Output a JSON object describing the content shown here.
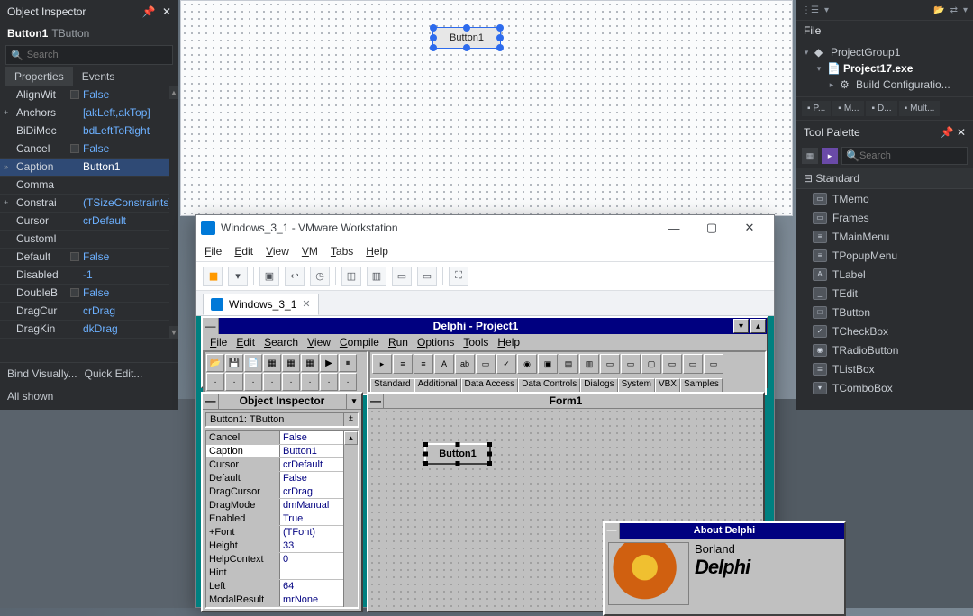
{
  "left": {
    "title": "Object Inspector",
    "selected_component": "Button1",
    "selected_class": "TButton",
    "search_placeholder": "Search",
    "tab_properties": "Properties",
    "tab_events": "Events",
    "rows": [
      {
        "expand": "",
        "name": "AlignWit",
        "check": true,
        "value": "False"
      },
      {
        "expand": "+",
        "name": "Anchors",
        "check": false,
        "value": "[akLeft,akTop]"
      },
      {
        "expand": "",
        "name": "BiDiMoc",
        "check": false,
        "value": "bdLeftToRight"
      },
      {
        "expand": "",
        "name": "Cancel",
        "check": true,
        "value": "False"
      },
      {
        "expand": "»",
        "name": "Caption",
        "check": false,
        "value": "Button1",
        "sel": true
      },
      {
        "expand": "",
        "name": "Comma",
        "check": false,
        "value": ""
      },
      {
        "expand": "+",
        "name": "Constrai",
        "check": false,
        "value": "(TSizeConstraints)"
      },
      {
        "expand": "",
        "name": "Cursor",
        "check": false,
        "value": "crDefault"
      },
      {
        "expand": "",
        "name": "CustomI",
        "check": false,
        "value": ""
      },
      {
        "expand": "",
        "name": "Default",
        "check": true,
        "value": "False"
      },
      {
        "expand": "",
        "name": "Disabled",
        "check": false,
        "value": "-1"
      },
      {
        "expand": "",
        "name": "DoubleB",
        "check": true,
        "value": "False"
      },
      {
        "expand": "",
        "name": "DragCur",
        "check": false,
        "value": "crDrag"
      },
      {
        "expand": "",
        "name": "DragKin",
        "check": false,
        "value": "dkDrag"
      }
    ],
    "bind_visually": "Bind Visually...",
    "quick_edit": "Quick Edit...",
    "all_shown": "All shown"
  },
  "center": {
    "button_caption": "Button1"
  },
  "right": {
    "file_sect": "File",
    "tree_root": "ProjectGroup1",
    "tree_exe": "Project17.exe",
    "tree_build": "Build Configuratio...",
    "tabs": [
      "P...",
      "M...",
      "D...",
      "Mult..."
    ],
    "palette_title": "Tool Palette",
    "palette_search": "Search",
    "category": "Standard",
    "items": [
      {
        "glyph": "▭",
        "label": "TMemo"
      },
      {
        "glyph": "▭",
        "label": "Frames"
      },
      {
        "glyph": "≡",
        "label": "TMainMenu"
      },
      {
        "glyph": "≡",
        "label": "TPopupMenu"
      },
      {
        "glyph": "A",
        "label": "TLabel"
      },
      {
        "glyph": "_",
        "label": "TEdit"
      },
      {
        "glyph": "□",
        "label": "TButton"
      },
      {
        "glyph": "✓",
        "label": "TCheckBox"
      },
      {
        "glyph": "◉",
        "label": "TRadioButton"
      },
      {
        "glyph": "≣",
        "label": "TListBox"
      },
      {
        "glyph": "▾",
        "label": "TComboBox"
      }
    ]
  },
  "vm": {
    "title": "Windows_3_1 - VMware Workstation",
    "menu": [
      "File",
      "Edit",
      "View",
      "VM",
      "Tabs",
      "Help"
    ],
    "tab_label": "Windows_3_1"
  },
  "d1": {
    "title": "Delphi - Project1",
    "menu": [
      "File",
      "Edit",
      "Search",
      "View",
      "Compile",
      "Run",
      "Options",
      "Tools",
      "Help"
    ],
    "palette_tabs": [
      "Standard",
      "Additional",
      "Data Access",
      "Data Controls",
      "Dialogs",
      "System",
      "VBX",
      "Samples"
    ],
    "oi_title": "Object Inspector",
    "oi_selected": "Button1: TButton",
    "oi_rows": [
      {
        "n": "Cancel",
        "v": "False"
      },
      {
        "n": "Caption",
        "v": "Button1",
        "hl": true
      },
      {
        "n": "Cursor",
        "v": "crDefault"
      },
      {
        "n": "Default",
        "v": "False"
      },
      {
        "n": "DragCursor",
        "v": "crDrag"
      },
      {
        "n": "DragMode",
        "v": "dmManual"
      },
      {
        "n": "Enabled",
        "v": "True"
      },
      {
        "n": "+Font",
        "v": "(TFont)"
      },
      {
        "n": "Height",
        "v": "33"
      },
      {
        "n": "HelpContext",
        "v": "0"
      },
      {
        "n": "Hint",
        "v": ""
      },
      {
        "n": "Left",
        "v": "64"
      },
      {
        "n": "ModalResult",
        "v": "mrNone"
      }
    ],
    "form_title": "Form1",
    "form_button": "Button1",
    "about_title": "About Delphi",
    "about_brand": "Borland",
    "about_product": "Delphi"
  }
}
